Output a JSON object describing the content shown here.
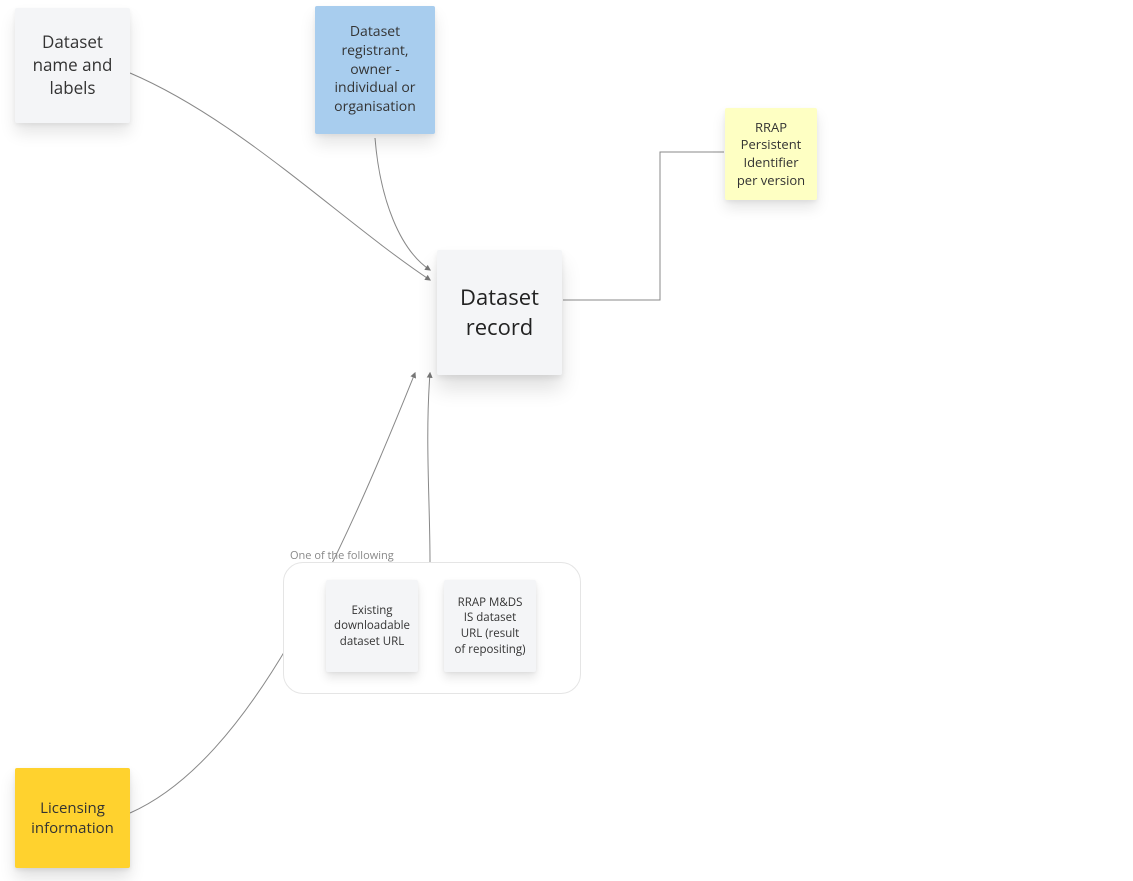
{
  "nodes": {
    "dataset_name": {
      "text": "Dataset name and labels"
    },
    "dataset_registrant": {
      "text": "Dataset registrant, owner - individual or organisation"
    },
    "dataset_record": {
      "text": "Dataset record"
    },
    "rrap_pid": {
      "text": "RRAP Persistent Identifier per version"
    },
    "licensing": {
      "text": "Licensing information"
    },
    "option_existing_url": {
      "text": "Existing downloadable dataset URL"
    },
    "option_rrap_url": {
      "text": "RRAP M&DS IS dataset URL (result of repositing)"
    }
  },
  "group": {
    "label": "One of the following"
  },
  "colors": {
    "gray": "#f4f5f7",
    "blue": "#a8cdee",
    "yellow": "#feffc3",
    "gold": "#ffd22e",
    "connector": "#888888"
  }
}
